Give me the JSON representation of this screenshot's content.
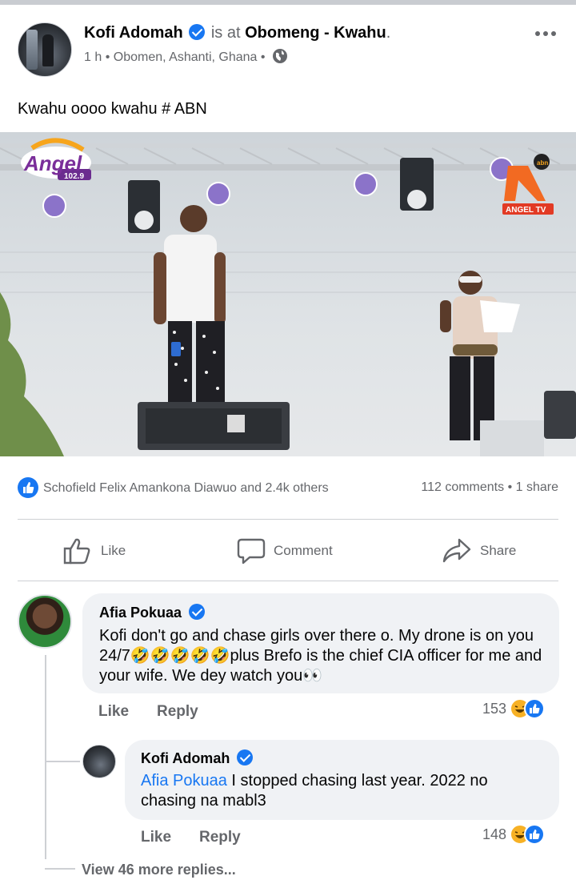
{
  "post": {
    "author": "Kofi Adomah",
    "is_at_label": "is at",
    "place": "Obomeng - Kwahu",
    "place_suffix": ".",
    "time": "1 h",
    "sep": "•",
    "location": "Obomen, Ashanti, Ghana",
    "privacy_icon": "globe-icon",
    "text": "Kwahu oooo kwahu # ABN"
  },
  "photo": {
    "logo_left_text": "Angel",
    "logo_left_freq": "102.9",
    "logo_right_text": "ANGEL TV",
    "logo_right_badge": "abn"
  },
  "engagement": {
    "reactions_text": "Schofield Felix Amankona Diawuo and 2.4k others",
    "comments": "112 comments",
    "sep": "•",
    "shares": "1 share"
  },
  "actions": {
    "like": "Like",
    "comment": "Comment",
    "share": "Share"
  },
  "comments": [
    {
      "author": "Afia Pokuaa",
      "text": "Kofi don't go and chase girls over there o. My drone is on you 24/7🤣🤣🤣🤣🤣plus Brefo is the chief CIA officer for me and your wife. We dey watch you👀",
      "like_label": "Like",
      "reply_label": "Reply",
      "reaction_count": "153"
    },
    {
      "author": "Kofi Adomah",
      "mention": "Afia Pokuaa",
      "text": " I stopped chasing last year. 2022 no chasing na mabl3",
      "like_label": "Like",
      "reply_label": "Reply",
      "reaction_count": "148"
    }
  ],
  "more_replies": "View 46 more replies...",
  "colors": {
    "accent": "#1877f2",
    "secondary_text": "#65676b",
    "bubble": "#f0f2f5"
  }
}
